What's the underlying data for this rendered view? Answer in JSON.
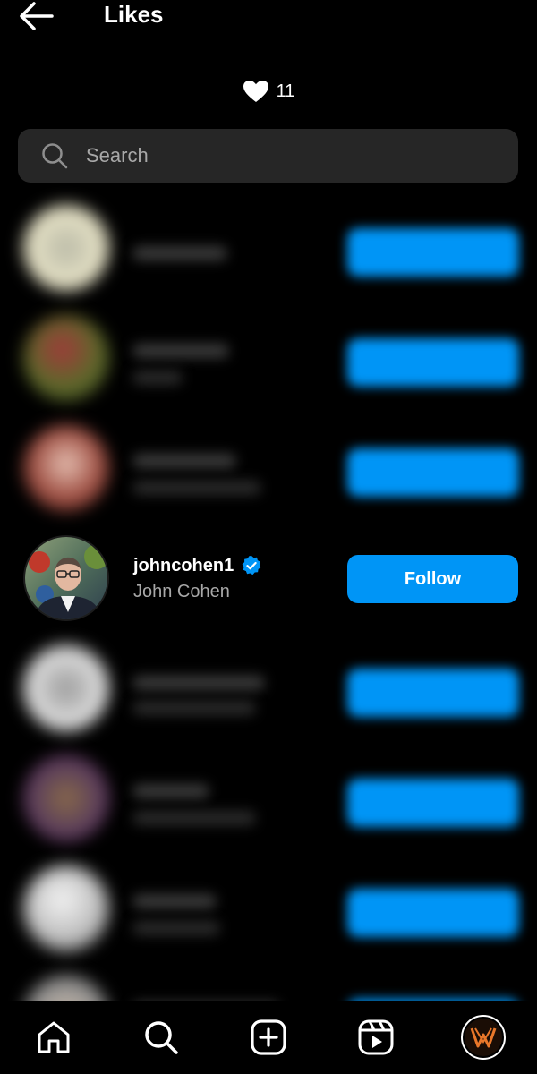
{
  "header": {
    "title": "Likes",
    "likes_count": "11"
  },
  "search": {
    "placeholder": "Search"
  },
  "featured_user": {
    "username": "johncohen1",
    "full_name": "John Cohen",
    "verified": true,
    "button_label": "Follow"
  },
  "colors": {
    "accent": "#0095f6",
    "background": "#000000",
    "search_bg": "#262626",
    "secondary_text": "#a8a8a8"
  },
  "icons": {
    "back": "arrow-left-icon",
    "like": "heart-icon",
    "search": "search-icon",
    "verified": "verified-badge-icon",
    "nav": [
      "home-icon",
      "search-icon",
      "create-icon",
      "reels-icon",
      "profile-avatar"
    ]
  }
}
